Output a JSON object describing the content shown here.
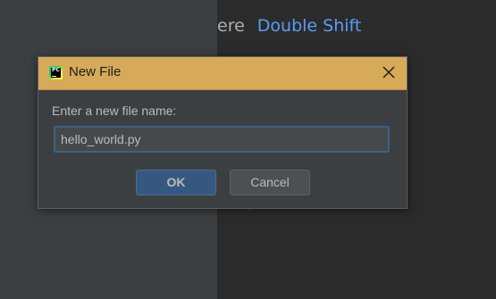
{
  "background": {
    "hint_text": "ere",
    "hint_shortcut": "Double Shift"
  },
  "dialog": {
    "title": "New File",
    "app_icon_label": "PC",
    "prompt": "Enter a new file name:",
    "filename_value": "hello_world.py",
    "ok_label": "OK",
    "cancel_label": "Cancel"
  },
  "colors": {
    "titlebar": "#d6aa58",
    "dialog_bg": "#3c3f41",
    "editor_bg": "#2b2b2b",
    "shortcut": "#589df6",
    "ok_button": "#365880",
    "input_focus_border": "#3d6185"
  },
  "icons": {
    "close": "close-icon",
    "app": "pycharm-icon"
  }
}
